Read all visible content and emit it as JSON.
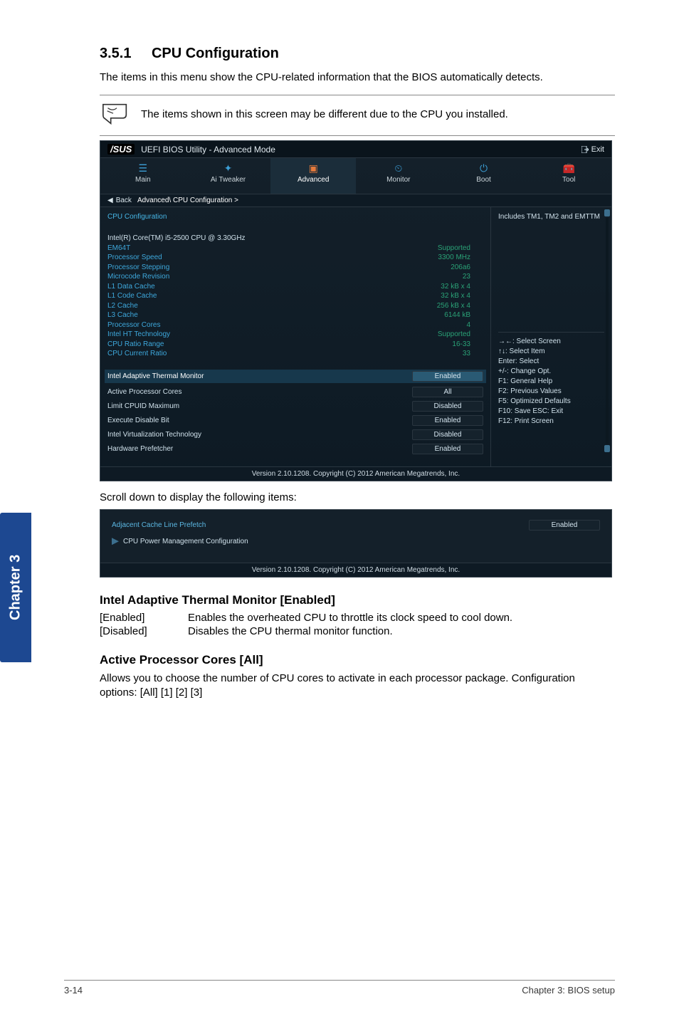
{
  "section": {
    "number": "3.5.1",
    "title": "CPU Configuration"
  },
  "intro": "The items in this menu show the CPU-related information that the BIOS automatically detects.",
  "note": "The items shown in this screen may be different due to the CPU you installed.",
  "bios": {
    "brand": "/SUS",
    "title": "UEFI BIOS Utility - Advanced Mode",
    "exit": "Exit",
    "tabs": {
      "main": "Main",
      "ai": "Ai Tweaker",
      "advanced": "Advanced",
      "monitor": "Monitor",
      "boot": "Boot",
      "tool": "Tool"
    },
    "breadcrumb": {
      "back": "Back",
      "path": "Advanced\\ CPU Configuration >"
    },
    "group_title": "CPU Configuration",
    "cpu_name": "Intel(R) Core(TM) i5-2500 CPU @ 3.30GHz",
    "info": {
      "em64t": {
        "k": "EM64T",
        "v": "Supported"
      },
      "speed": {
        "k": "Processor Speed",
        "v": "3300 MHz"
      },
      "stepping": {
        "k": "Processor Stepping",
        "v": "206a6"
      },
      "microcode": {
        "k": "Microcode Revision",
        "v": "23"
      },
      "l1d": {
        "k": "L1 Data Cache",
        "v": "32 kB x 4"
      },
      "l1c": {
        "k": "L1 Code Cache",
        "v": "32 kB x 4"
      },
      "l2": {
        "k": "L2 Cache",
        "v": "256 kB x 4"
      },
      "l3": {
        "k": "L3 Cache",
        "v": "6144 kB"
      },
      "cores": {
        "k": "Processor Cores",
        "v": "4"
      },
      "ht": {
        "k": "Intel HT Technology",
        "v": "Supported"
      },
      "ratio_range": {
        "k": "CPU Ratio Range",
        "v": "16-33"
      },
      "ratio_current": {
        "k": "CPU Current Ratio",
        "v": "33"
      }
    },
    "options": {
      "thermal": {
        "label": "Intel Adaptive Thermal Monitor",
        "value": "Enabled"
      },
      "active_cores": {
        "label": "Active Processor Cores",
        "value": "All"
      },
      "cpuid": {
        "label": "Limit CPUID Maximum",
        "value": "Disabled"
      },
      "xd": {
        "label": "Execute Disable Bit",
        "value": "Enabled"
      },
      "vt": {
        "label": "Intel Virtualization Technology",
        "value": "Disabled"
      },
      "prefetch": {
        "label": "Hardware Prefetcher",
        "value": "Enabled"
      }
    },
    "right": {
      "top": "Includes TM1, TM2 and EMTTM",
      "hints": {
        "l1": "→←: Select Screen",
        "l2": "↑↓: Select Item",
        "l3": "Enter: Select",
        "l4": "+/-: Change Opt.",
        "l5": "F1: General Help",
        "l6": "F2: Previous Values",
        "l7": "F5: Optimized Defaults",
        "l8": "F10: Save   ESC: Exit",
        "l9": "F12: Print Screen"
      }
    },
    "footer": "Version 2.10.1208.   Copyright (C) 2012 American Megatrends, Inc."
  },
  "scroll_caption": "Scroll down to display the following items:",
  "bios2": {
    "row1": {
      "label": "Adjacent Cache Line Prefetch",
      "value": "Enabled"
    },
    "row2": {
      "label": "CPU Power Management Configuration"
    },
    "footer": "Version 2.10.1208.   Copyright (C) 2012 American Megatrends, Inc."
  },
  "sidebar": "Chapter 3",
  "opt1": {
    "title": "Intel Adaptive Thermal Monitor [Enabled]",
    "r1k": "[Enabled]",
    "r1v": "Enables the overheated CPU to throttle its clock speed to cool down.",
    "r2k": "[Disabled]",
    "r2v": "Disables the CPU thermal monitor function."
  },
  "opt2": {
    "title": "Active Processor Cores [All]",
    "body": "Allows you to choose the number of CPU cores to activate in each processor package. Configuration options: [All] [1] [2] [3]"
  },
  "footer": {
    "left": "3-14",
    "right": "Chapter 3: BIOS setup"
  }
}
